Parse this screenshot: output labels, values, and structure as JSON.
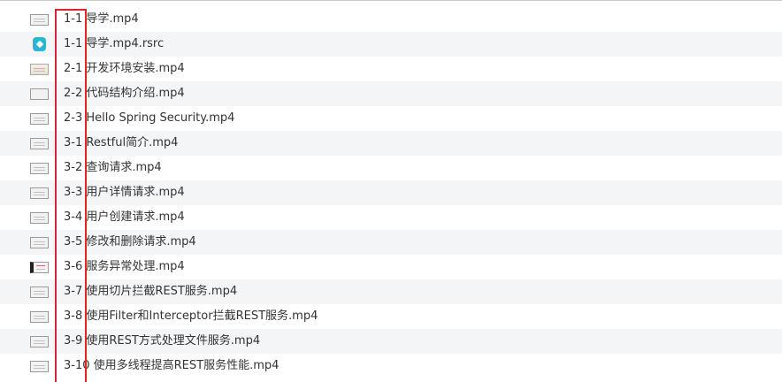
{
  "files": [
    {
      "name": "1-1 导学.mp4",
      "icon": "video-thumbnail-icon"
    },
    {
      "name": "1-1 导学.mp4.rsrc",
      "icon": "resource-app-icon"
    },
    {
      "name": "2-1 开发环境安装.mp4",
      "icon": "video-thumbnail-icon"
    },
    {
      "name": "2-2 代码结构介绍.mp4",
      "icon": "video-thumbnail-icon"
    },
    {
      "name": "2-3 Hello Spring Security.mp4",
      "icon": "video-thumbnail-icon"
    },
    {
      "name": "3-1 Restful简介.mp4",
      "icon": "video-thumbnail-icon"
    },
    {
      "name": "3-2 查询请求.mp4",
      "icon": "video-thumbnail-icon"
    },
    {
      "name": "3-3 用户详情请求.mp4",
      "icon": "video-thumbnail-icon"
    },
    {
      "name": "3-4 用户创建请求.mp4",
      "icon": "video-thumbnail-icon"
    },
    {
      "name": "3-5 修改和删除请求.mp4",
      "icon": "video-thumbnail-icon"
    },
    {
      "name": "3-6 服务异常处理.mp4",
      "icon": "video-thumbnail-icon"
    },
    {
      "name": "3-7 使用切片拦截REST服务.mp4",
      "icon": "video-thumbnail-icon"
    },
    {
      "name": "3-8 使用Filter和Interceptor拦截REST服务.mp4",
      "icon": "video-thumbnail-icon"
    },
    {
      "name": "3-9 使用REST方式处理文件服务.mp4",
      "icon": "video-thumbnail-icon"
    },
    {
      "name": "3-10 使用多线程提高REST服务性能.mp4",
      "icon": "video-thumbnail-icon"
    }
  ],
  "colors": {
    "highlight": "#e0242e",
    "row_alt": "#f4f5f7",
    "app_icon": "#29b6d3"
  }
}
